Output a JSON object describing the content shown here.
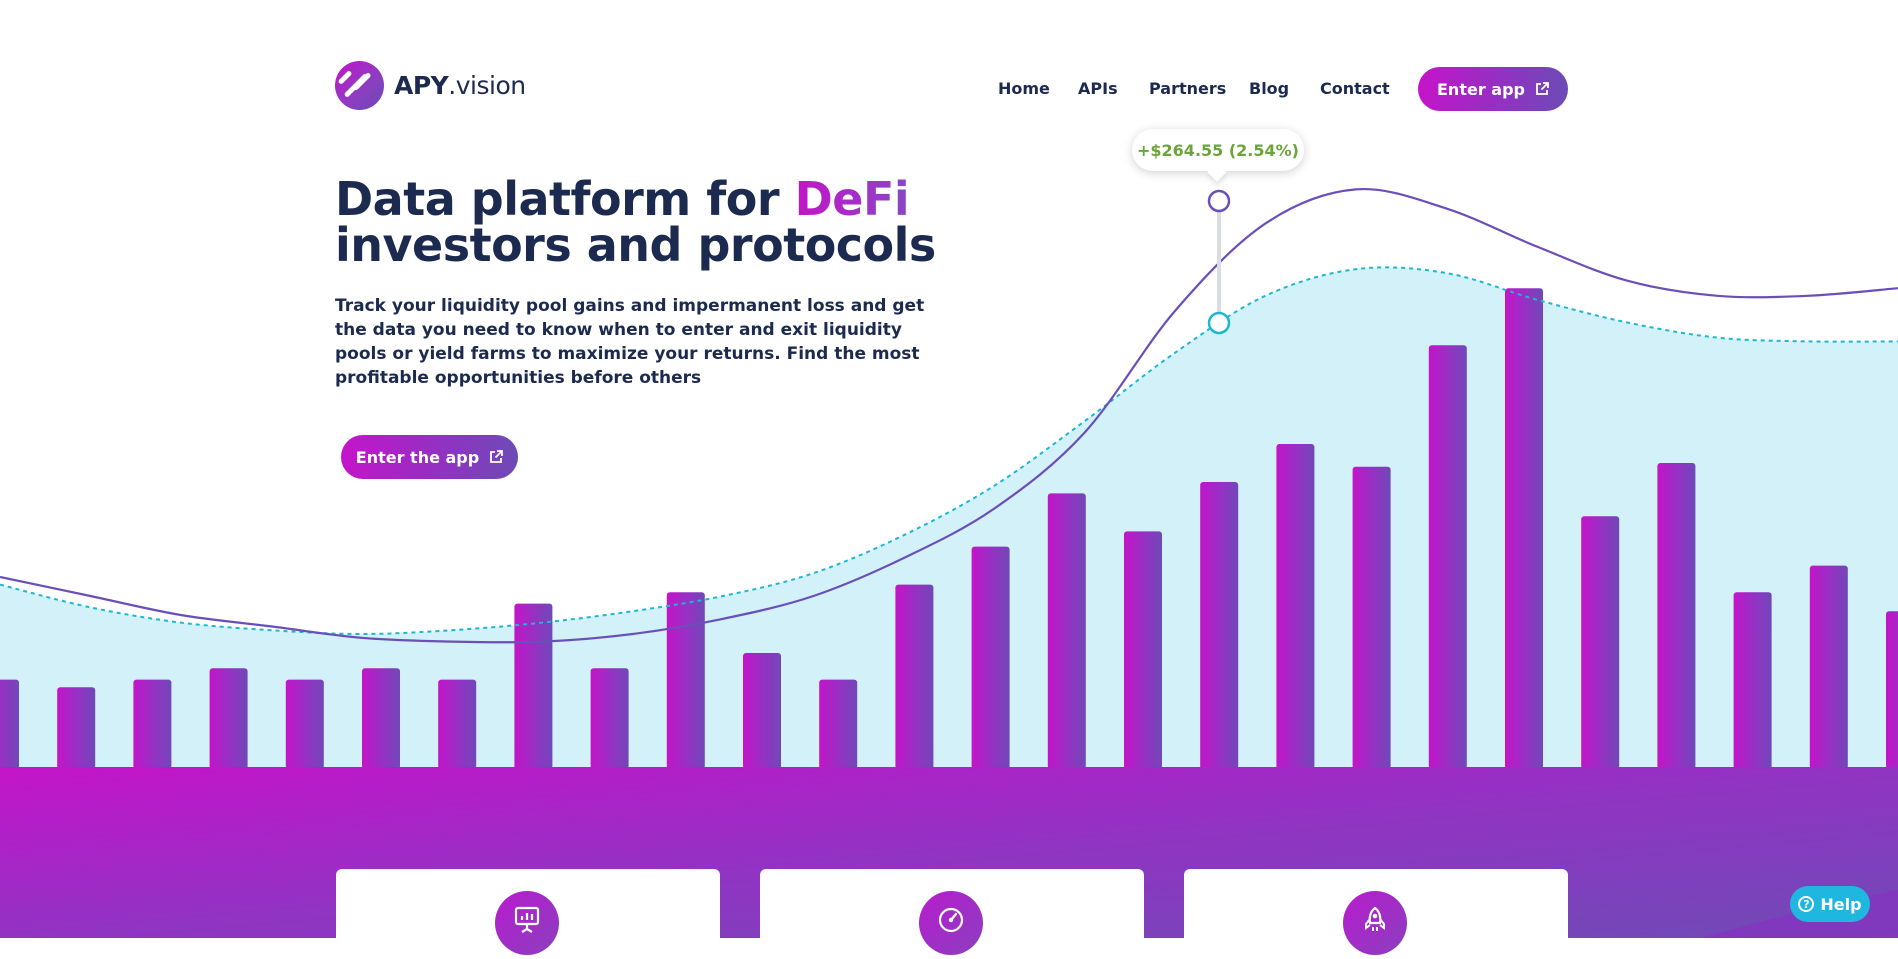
{
  "brand": {
    "name_bold": "APY",
    "name_rest": ".vision"
  },
  "nav": {
    "items": [
      {
        "label": "Home"
      },
      {
        "label": "APIs"
      },
      {
        "label": "Partners"
      },
      {
        "label": "Blog"
      },
      {
        "label": "Contact"
      }
    ],
    "cta_label": "Enter app"
  },
  "hero": {
    "title_line1": "Data platform for",
    "title_accent": "DeFi",
    "title_line2": "investors and protocols",
    "description": "Track your liquidity pool gains and impermanent loss and get the data you need to know when to enter and exit liquidity pools or yield farms to maximize your returns. Find the most profitable opportunities before others",
    "cta_label": "Enter the app"
  },
  "tooltip": {
    "text": "+$264.55 (2.54%)"
  },
  "help": {
    "label": "Help"
  },
  "cards": [
    {
      "icon": "presentation-chart-icon"
    },
    {
      "icon": "speedometer-icon"
    },
    {
      "icon": "rocket-icon"
    }
  ],
  "colors": {
    "navy": "#1b2a4e",
    "magenta": "#c414c9",
    "purple": "#6d4bb5",
    "line_purple": "#6a4fb8",
    "cyan": "#1fb6d0",
    "area_fill": "#d2f1f8",
    "gain_green": "#6aa53a",
    "help_blue": "#1fb6e0"
  },
  "chart_data": {
    "type": "bar",
    "title": "",
    "xlabel": "",
    "ylabel": "",
    "grid": false,
    "values": [
      23,
      21,
      23,
      26,
      23,
      26,
      23,
      43,
      26,
      46,
      30,
      23,
      48,
      58,
      72,
      62,
      75,
      85,
      79,
      111,
      126,
      66,
      80,
      46,
      53,
      41
    ],
    "ylim": [
      0,
      140
    ],
    "series": [
      {
        "values": [
          50,
          45,
          40,
          37,
          34,
          33,
          33,
          35,
          39,
          45,
          55,
          68,
          88,
          120,
          143,
          152,
          147,
          137,
          128,
          124,
          124,
          126
        ]
      },
      {
        "values": [
          48,
          42,
          38,
          36,
          35,
          36,
          38,
          41,
          45,
          51,
          61,
          74,
          91,
          109,
          124,
          131,
          130,
          123,
          117,
          113,
          112,
          112
        ]
      }
    ]
  }
}
